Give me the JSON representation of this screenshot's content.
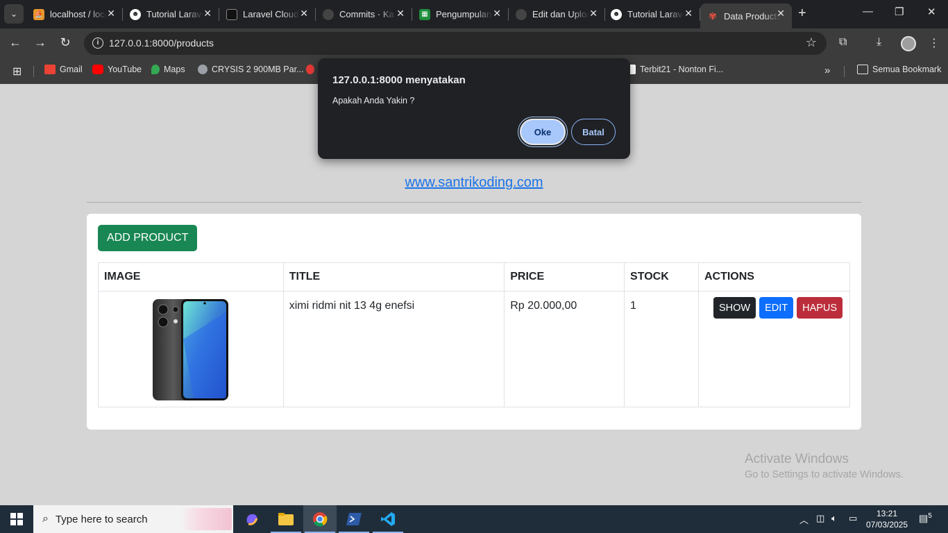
{
  "browser": {
    "tabs": [
      {
        "title": "localhost / localhost",
        "favicon": "phpmyadmin-icon",
        "color": "#e8962b"
      },
      {
        "title": "Tutorial Laravel",
        "favicon": "santrikoding-icon",
        "color": "#ffffff"
      },
      {
        "title": "Laravel Cloud",
        "favicon": "laravel-cloud-icon",
        "color": "#111111"
      },
      {
        "title": "Commits · Ka",
        "favicon": "github-icon",
        "color": "#444444"
      },
      {
        "title": "Pengumpulan",
        "favicon": "google-sheets-icon",
        "color": "#1e8e3e"
      },
      {
        "title": "Edit dan Upload",
        "favicon": "github-icon",
        "color": "#444444"
      },
      {
        "title": "Tutorial Laravel",
        "favicon": "santrikoding-icon",
        "color": "#ffffff"
      },
      {
        "title": "Data Products",
        "favicon": "laravel-icon",
        "color": "#f05340"
      }
    ],
    "address": "127.0.0.1:8000/products",
    "bookmarks": [
      {
        "label": "Gmail",
        "icon": "gmail-icon",
        "color": "#ea4335"
      },
      {
        "label": "YouTube",
        "icon": "youtube-icon",
        "color": "#ff0000"
      },
      {
        "label": "Maps",
        "icon": "maps-icon",
        "color": "#34a853"
      },
      {
        "label": "CRYSIS 2 900MB Par...",
        "icon": "globe-icon",
        "color": "#e3e3e3"
      },
      {
        "label": "Terbit21 - Nonton Fi...",
        "icon": "terbit21-icon",
        "color": "#ffffff"
      }
    ],
    "all_bookmarks": "Semua Bookmark"
  },
  "page": {
    "site_link": "www.santrikoding.com",
    "add_button": "ADD PRODUCT",
    "table": {
      "headers": [
        "IMAGE",
        "TITLE",
        "PRICE",
        "STOCK",
        "ACTIONS"
      ],
      "rows": [
        {
          "title": "ximi ridmi nit 13 4g enefsi",
          "price": "Rp 20.000,00",
          "stock": "1"
        }
      ]
    },
    "actions": {
      "show": "SHOW",
      "edit": "EDIT",
      "delete": "HAPUS"
    },
    "action_colors": {
      "show": "#212529",
      "edit": "#0d6efd",
      "delete": "#bb2d3b",
      "add": "#198754"
    }
  },
  "dialog": {
    "title": "127.0.0.1:8000 menyatakan",
    "message": "Apakah Anda Yakin ?",
    "ok": "Oke",
    "cancel": "Batal"
  },
  "watermark": {
    "line1": "Activate Windows",
    "line2": "Go to Settings to activate Windows."
  },
  "taskbar": {
    "search_placeholder": "Type here to search",
    "apps": [
      "copilot-icon",
      "file-explorer-icon",
      "chrome-icon",
      "powershell-icon",
      "vscode-icon"
    ],
    "time": "13:21",
    "date": "07/03/2025",
    "notifications": "5"
  }
}
